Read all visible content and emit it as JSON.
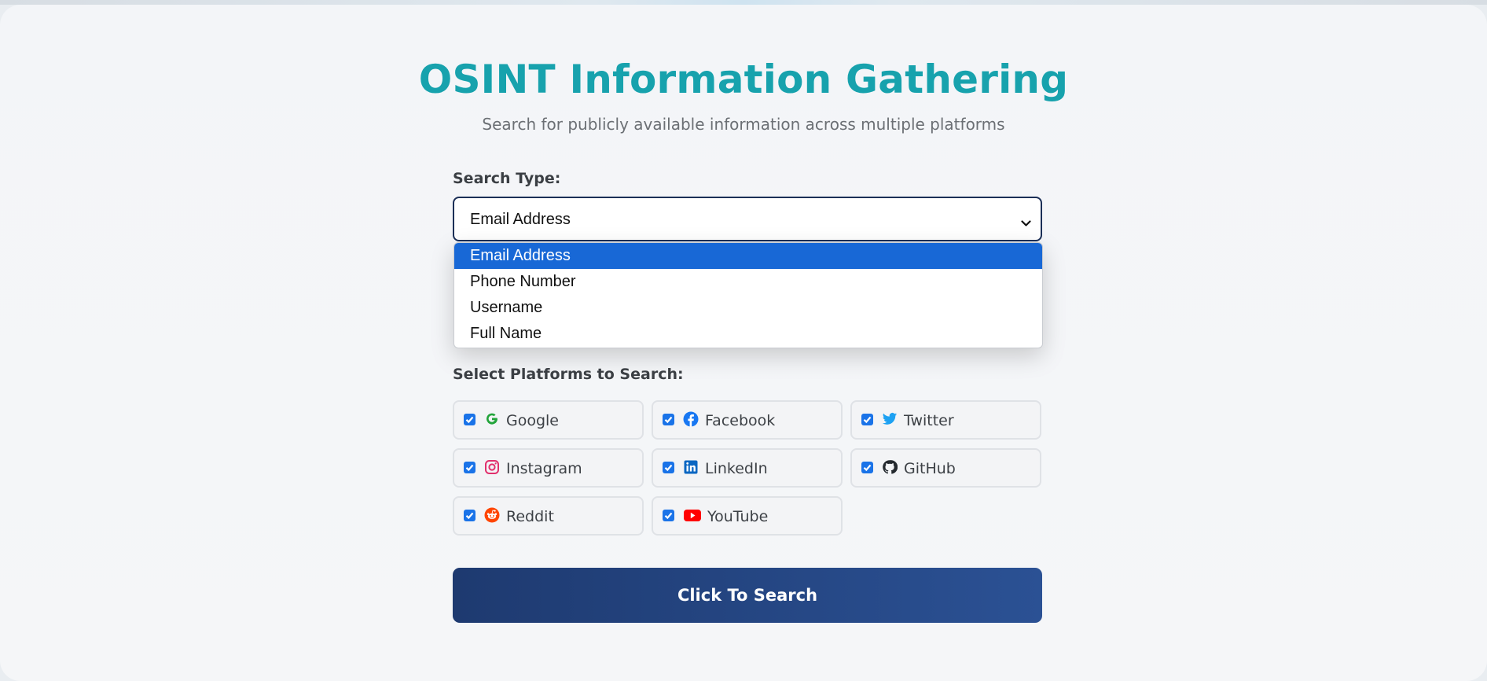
{
  "header": {
    "title": "OSINT Information Gathering",
    "subtitle": "Search for publicly available information across multiple platforms"
  },
  "search_type": {
    "label": "Search Type:",
    "selected": "Email Address",
    "options": [
      "Email Address",
      "Phone Number",
      "Username",
      "Full Name"
    ]
  },
  "platforms": {
    "label": "Select Platforms to Search:",
    "items": [
      {
        "name": "Google",
        "checked": true,
        "icon": "google-icon",
        "color": "#34a853"
      },
      {
        "name": "Facebook",
        "checked": true,
        "icon": "facebook-icon",
        "color": "#1877f2"
      },
      {
        "name": "Twitter",
        "checked": true,
        "icon": "twitter-icon",
        "color": "#1da1f2"
      },
      {
        "name": "Instagram",
        "checked": true,
        "icon": "instagram-icon",
        "color": "#e1306c"
      },
      {
        "name": "LinkedIn",
        "checked": true,
        "icon": "linkedin-icon",
        "color": "#0a66c2"
      },
      {
        "name": "GitHub",
        "checked": true,
        "icon": "github-icon",
        "color": "#24292e"
      },
      {
        "name": "Reddit",
        "checked": true,
        "icon": "reddit-icon",
        "color": "#ff4500"
      },
      {
        "name": "YouTube",
        "checked": true,
        "icon": "youtube-icon",
        "color": "#ff0000"
      }
    ]
  },
  "search_button": {
    "label": "Click To Search"
  }
}
